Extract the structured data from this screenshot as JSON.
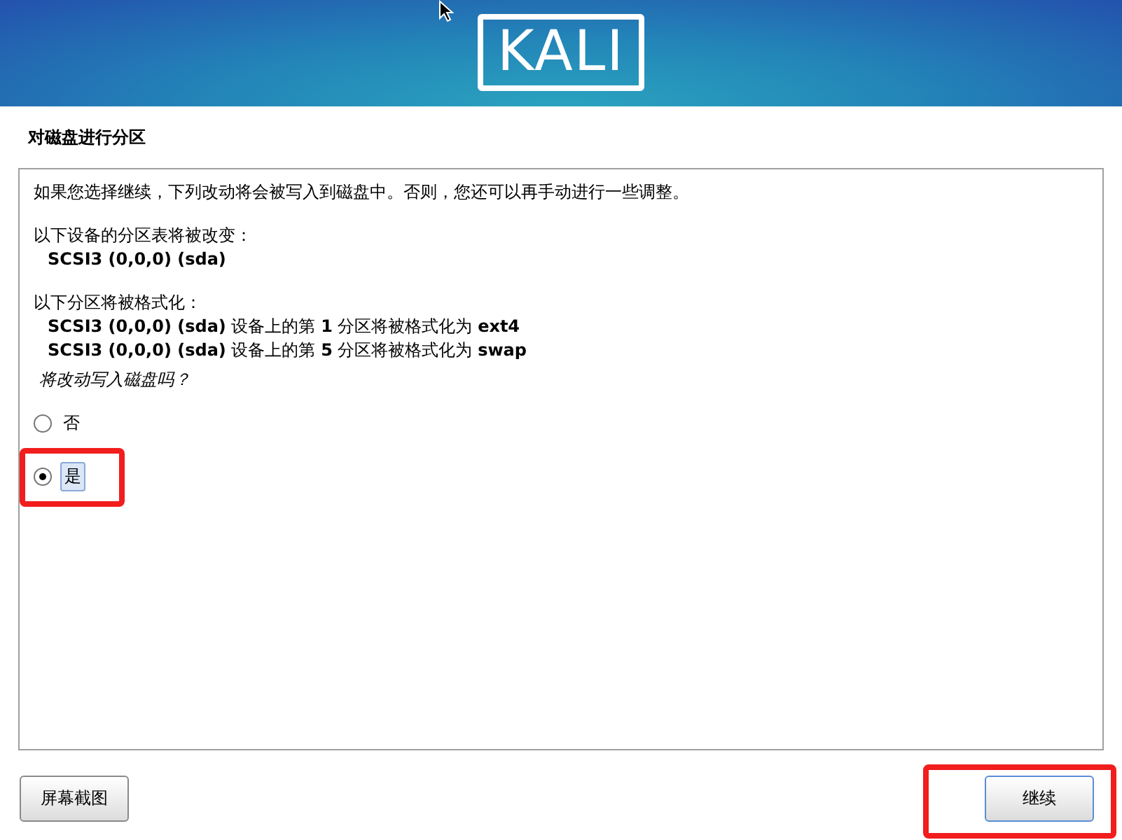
{
  "header": {
    "logo": "KALI"
  },
  "title": "对磁盘进行分区",
  "panel": {
    "intro": "如果您选择继续，下列改动将会被写入到磁盘中。否则，您还可以再手动进行一些调整。",
    "sections": [
      {
        "heading": "以下设备的分区表将被改变：",
        "items": [
          "**SCSI3 (0,0,0) (sda)**"
        ]
      },
      {
        "heading": "以下分区将被格式化：",
        "items": [
          "**SCSI3 (0,0,0) (sda)** 设备上的第 **1** 分区将被格式化为 **ext4**",
          "**SCSI3 (0,0,0) (sda)** 设备上的第 **5** 分区将被格式化为 **swap**"
        ]
      }
    ],
    "question": "将改动写入磁盘吗？",
    "options": [
      {
        "label": "否",
        "selected": false,
        "highlighted": false
      },
      {
        "label": "是",
        "selected": true,
        "highlighted": true
      }
    ]
  },
  "buttons": [
    {
      "label": "屏幕截图",
      "kind": "secondary",
      "highlighted": false
    },
    {
      "label": "继续",
      "kind": "primary",
      "highlighted": true
    }
  ]
}
